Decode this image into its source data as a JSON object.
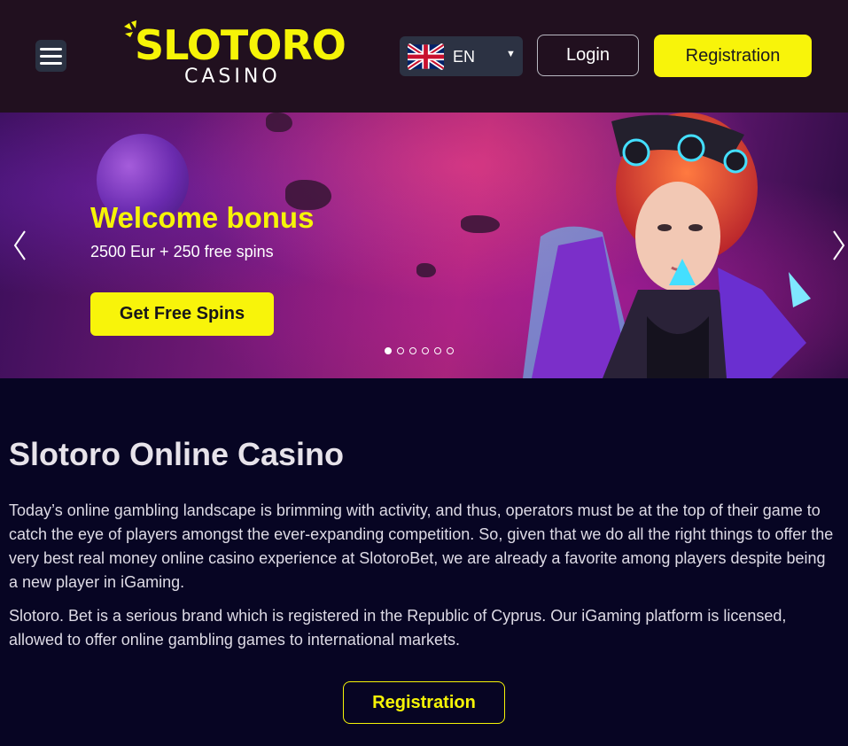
{
  "header": {
    "logo_main": "SLOTORO",
    "logo_sub": "CASINO",
    "language": {
      "code": "EN",
      "flag": "uk-flag-icon"
    },
    "login_label": "Login",
    "registration_label": "Registration"
  },
  "hero": {
    "title": "Welcome bonus",
    "subtitle": "2500 Eur + 250 free spins",
    "cta_label": "Get Free Spins",
    "slides_total": 6,
    "active_slide": 1
  },
  "content": {
    "title": "Slotoro Online Casino",
    "paragraphs": [
      "Today’s online gambling landscape is brimming with activity, and thus, operators must be at the top of their game to catch the eye of players amongst the ever-expanding competition. So, given that we do all the right things to offer the very best real money online casino experience at SlotoroBet, we are already a favorite among players despite being a new player in iGaming.",
      "Slotoro. Bet is a serious brand which is registered in the Republic of Cyprus. Our iGaming platform is licensed, allowed to offer online gambling games to international markets."
    ],
    "registration_label": "Registration"
  },
  "colors": {
    "accent": "#f8f40a",
    "header_bg": "#21101f",
    "page_bg": "#070523"
  }
}
